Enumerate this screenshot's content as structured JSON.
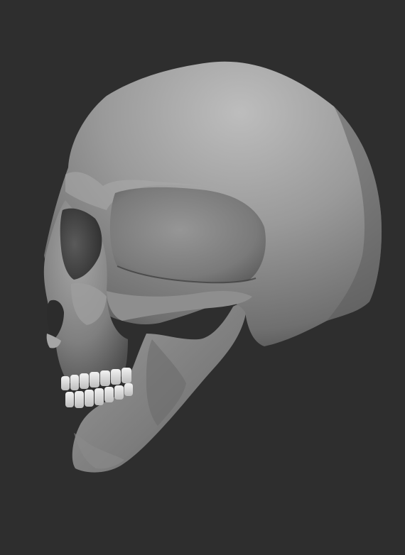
{
  "scene": {
    "background_color": "#2e2e2e",
    "subject": "skull-model",
    "material_color": "#9a9a9a",
    "teeth_color": "#e6e6e6"
  }
}
